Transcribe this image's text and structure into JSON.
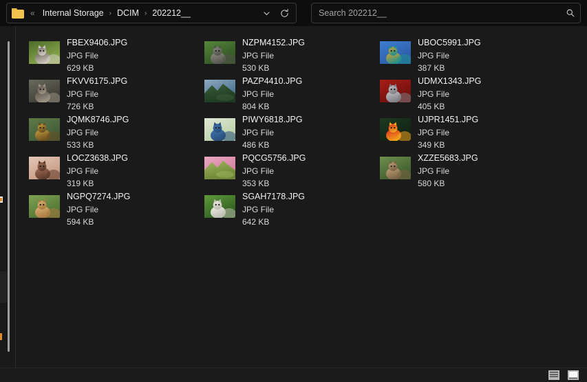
{
  "window": {
    "title": "202212__"
  },
  "addressbar": {
    "folder_icon": "folder-icon",
    "overflow_label": "«",
    "crumbs": [
      "Internal Storage",
      "DCIM",
      "202212__"
    ],
    "separator": "›",
    "dropdown_icon": "chevron-down-icon",
    "refresh_icon": "refresh-icon"
  },
  "search": {
    "value": "",
    "placeholder": "Search 202212__",
    "icon": "search-icon"
  },
  "files": [
    {
      "name": "FBEX9406.JPG",
      "type": "JPG File",
      "size": "629 KB",
      "thumb": "kitten-grass"
    },
    {
      "name": "FKVV6175.JPG",
      "type": "JPG File",
      "size": "726 KB",
      "thumb": "cat-rock"
    },
    {
      "name": "JQMK8746.JPG",
      "type": "JPG File",
      "size": "533 KB",
      "thumb": "duckling-water"
    },
    {
      "name": "LOCZ3638.JPG",
      "type": "JPG File",
      "size": "319 KB",
      "thumb": "puppy-sleep"
    },
    {
      "name": "NGPQ7274.JPG",
      "type": "JPG File",
      "size": "594 KB",
      "thumb": "golden-retriever"
    },
    {
      "name": "NZPM4152.JPG",
      "type": "JPG File",
      "size": "530 KB",
      "thumb": "kitten-green"
    },
    {
      "name": "PAZP4410.JPG",
      "type": "JPG File",
      "size": "804 KB",
      "thumb": "lake-mountain"
    },
    {
      "name": "PIWY6818.JPG",
      "type": "JPG File",
      "size": "486 KB",
      "thumb": "bird-blossom"
    },
    {
      "name": "PQCG5756.JPG",
      "type": "JPG File",
      "size": "353 KB",
      "thumb": "pink-blossom"
    },
    {
      "name": "SGAH7178.JPG",
      "type": "JPG File",
      "size": "642 KB",
      "thumb": "lamb-grass"
    },
    {
      "name": "UBOC5991.JPG",
      "type": "JPG File",
      "size": "387 KB",
      "thumb": "dragonfly-blue"
    },
    {
      "name": "UDMX1343.JPG",
      "type": "JPG File",
      "size": "405 KB",
      "thumb": "red-coral"
    },
    {
      "name": "UJPR1451.JPG",
      "type": "JPG File",
      "size": "349 KB",
      "thumb": "macaw-red"
    },
    {
      "name": "XZZE5683.JPG",
      "type": "JPG File",
      "size": "580 KB",
      "thumb": "lynx-cat"
    }
  ],
  "statusbar": {
    "view_details_icon": "view-details-icon",
    "view_large_icons_icon": "view-large-icons-icon"
  },
  "colors": {
    "background": "#0d0d0d",
    "panel": "#1a1a1a",
    "rail": "#191919",
    "border": "#3a3a3a",
    "text": "#f0f0f0",
    "text_muted": "#d8d8d8",
    "folder_accent": "#f1c34e",
    "scrollbar": "#9d9d9d"
  }
}
